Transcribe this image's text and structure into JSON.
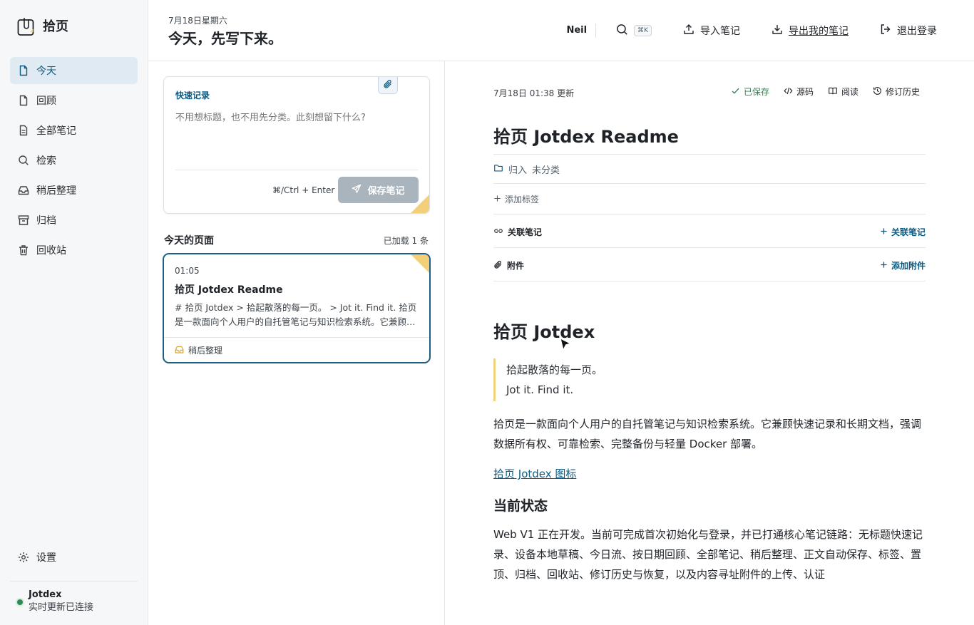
{
  "brand": {
    "name": "拾页"
  },
  "sidebar": {
    "items": [
      {
        "label": "今天",
        "icon": "file-icon",
        "active": true
      },
      {
        "label": "回顾",
        "icon": "file-icon"
      },
      {
        "label": "全部笔记",
        "icon": "file-text-icon"
      },
      {
        "label": "检索",
        "icon": "search-icon"
      },
      {
        "label": "稍后整理",
        "icon": "inbox-icon"
      },
      {
        "label": "归档",
        "icon": "archive-icon"
      },
      {
        "label": "回收站",
        "icon": "trash-icon"
      }
    ],
    "settings_label": "设置",
    "status_title": "Jotdex",
    "status_sub": "实时更新已连接"
  },
  "header": {
    "date": "7月18日星期六",
    "title": "今天，先写下来。",
    "user": "Neil",
    "search_kbd": "⌘K",
    "import_label": "导入笔记",
    "export_label": "导出我的笔记",
    "logout_label": "退出登录"
  },
  "quick": {
    "label": "快速记录",
    "placeholder": "不用想标题，也不用先分类。此刻想留下什么?",
    "shortcut": "⌘/Ctrl + Enter",
    "save_label": "保存笔记"
  },
  "today": {
    "heading": "今天的页面",
    "loaded": "已加载 1 条",
    "card": {
      "time": "01:05",
      "title": "拾页 Jotdex Readme",
      "excerpt": "# 拾页 Jotdex > 拾起散落的每一页。 > Jot it. Find it. 拾页是一款面向个人用户的自托管笔记与知识检索系统。它兼顾快速记录和长期文档",
      "tag": "稍后整理"
    }
  },
  "note": {
    "updated": "7月18日 01:38 更新",
    "saved_label": "已保存",
    "source_label": "源码",
    "read_label": "阅读",
    "history_label": "修订历史",
    "title": "拾页 Jotdex Readme",
    "category_prefix": "归入",
    "category_value": "未分类",
    "add_tag": "添加标签",
    "linked_label": "关联笔记",
    "linked_action": "关联笔记",
    "attach_label": "附件",
    "attach_action": "添加附件",
    "content": {
      "h1": "拾页 Jotdex",
      "quote1": "拾起散落的每一页。",
      "quote2": "Jot it. Find it.",
      "p1": "拾页是一款面向个人用户的自托管笔记与知识检索系统。它兼顾快速记录和长期文档，强调数据所有权、可靠检索、完整备份与轻量 Docker 部署。",
      "link": "拾页 Jotdex 图标",
      "h2": "当前状态",
      "p2": "Web V1 正在开发。当前可完成首次初始化与登录，并已打通核心笔记链路：无标题快速记录、设备本地草稿、今日流、按日期回顾、全部笔记、稍后整理、正文自动保存、标签、置顶、归档、回收站、修订历史与恢复，以及内容寻址附件的上传、认证"
    }
  },
  "colors": {
    "accent": "#0b5a82",
    "active_bg": "#dfeaf3",
    "fold": "#f3cf7a",
    "saved": "#2e7d4f"
  }
}
